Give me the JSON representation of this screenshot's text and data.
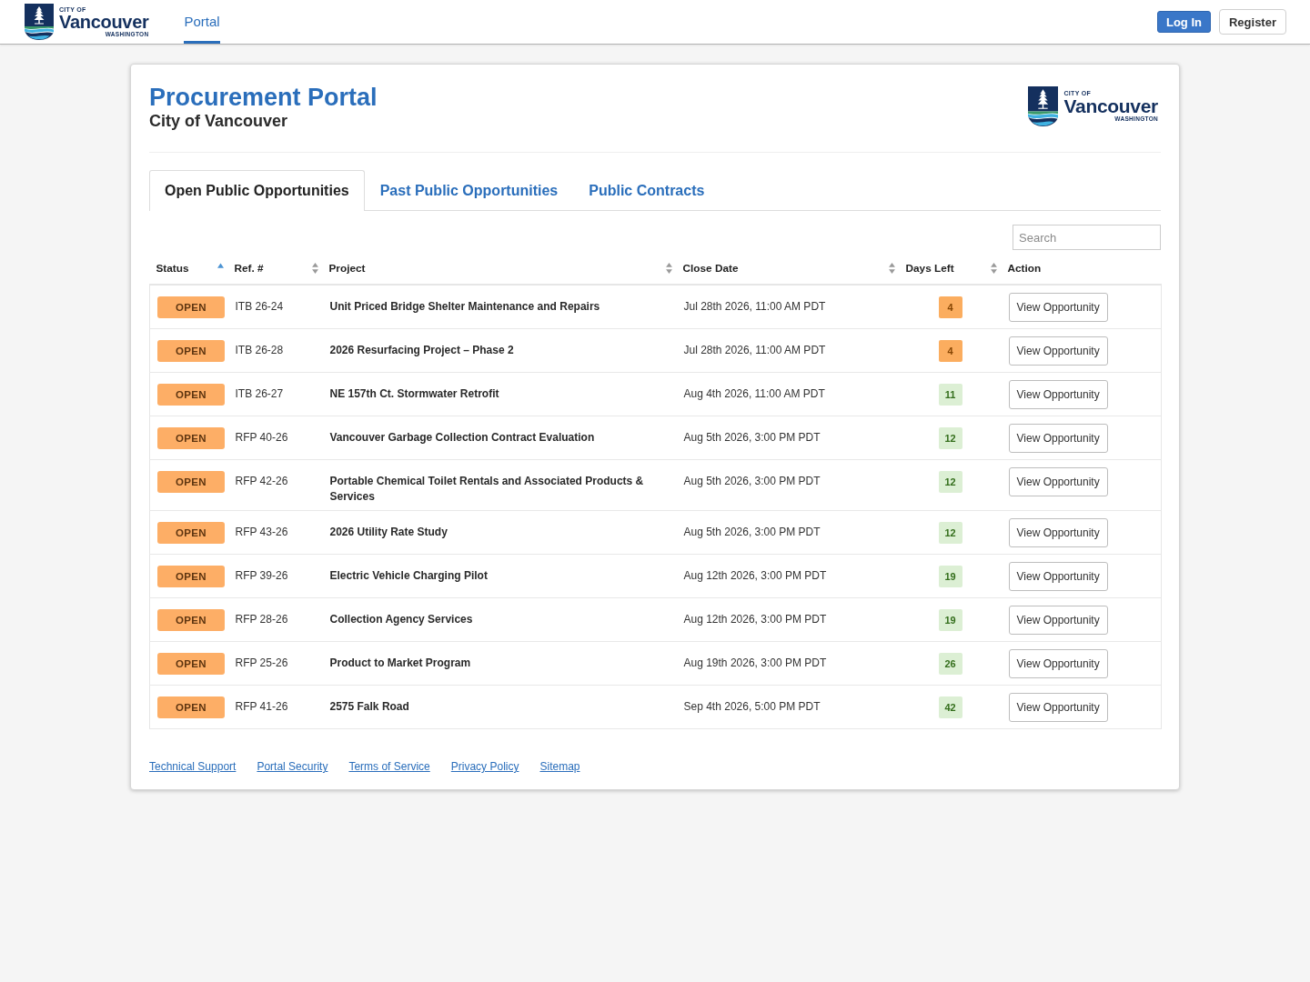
{
  "navbar": {
    "logo": {
      "line_1": "CITY OF",
      "name": "Vancouver",
      "line_2": "WASHINGTON"
    },
    "links": [
      {
        "label": "Portal",
        "selected": true
      }
    ],
    "buttons": [
      {
        "label": "Log In",
        "kind": "primary"
      },
      {
        "label": "Register",
        "kind": "secondary"
      }
    ]
  },
  "header": {
    "title": "Procurement Portal",
    "subtitle": "City of Vancouver",
    "logo": {
      "line_1": "CITY OF",
      "name": "Vancouver",
      "line_2": "WASHINGTON"
    }
  },
  "tabs": [
    {
      "label": "Open Public Opportunities",
      "selected": true
    },
    {
      "label": "Past Public Opportunities",
      "selected": false
    },
    {
      "label": "Public Contracts",
      "selected": false
    }
  ],
  "search": {
    "placeholder": "Search"
  },
  "table": {
    "columns": [
      {
        "label": "Status",
        "sorted": true
      },
      {
        "label": "Ref. #",
        "sorted": false
      },
      {
        "label": "Project",
        "sorted": false
      },
      {
        "label": "Close Date",
        "sorted": false
      },
      {
        "label": "Days Left",
        "sorted": false
      },
      {
        "label": "Action"
      }
    ],
    "rows": [
      {
        "status": "OPEN",
        "ref": "ITB 26-24",
        "project": "Unit Priced Bridge Shelter Maintenance and Repairs",
        "close_date": "Jul 28th 2026, 11:00 AM PDT",
        "days_left": {
          "text": "4",
          "color": "#fbad5f"
        },
        "action": "View Opportunity"
      },
      {
        "status": "OPEN",
        "ref": "ITB 26-28",
        "project": "2026 Resurfacing Project – Phase 2",
        "close_date": "Jul 28th 2026, 11:00 AM PDT",
        "days_left": {
          "text": "4",
          "color": "#fbad5f"
        },
        "action": "View Opportunity"
      },
      {
        "status": "OPEN",
        "ref": "ITB 26-27",
        "project": "NE 157th Ct. Stormwater Retrofit",
        "close_date": "Aug 4th 2026, 11:00 AM PDT",
        "days_left": {
          "text": "11",
          "color": "#dcefd4"
        },
        "action": "View Opportunity"
      },
      {
        "status": "OPEN",
        "ref": "RFP 40-26",
        "project": "Vancouver Garbage Collection Contract Evaluation",
        "close_date": "Aug 5th 2026, 3:00 PM PDT",
        "days_left": {
          "text": "12",
          "color": "#dcefd4"
        },
        "action": "View Opportunity"
      },
      {
        "status": "OPEN",
        "ref": "RFP 42-26",
        "project": "Portable Chemical Toilet Rentals and Associated Products & Services",
        "close_date": "Aug 5th 2026, 3:00 PM PDT",
        "days_left": {
          "text": "12",
          "color": "#dcefd4"
        },
        "action": "View Opportunity"
      },
      {
        "status": "OPEN",
        "ref": "RFP 43-26",
        "project": "2026 Utility Rate Study",
        "close_date": "Aug 5th 2026, 3:00 PM PDT",
        "days_left": {
          "text": "12",
          "color": "#dcefd4"
        },
        "action": "View Opportunity"
      },
      {
        "status": "OPEN",
        "ref": "RFP 39-26",
        "project": "Electric Vehicle Charging Pilot",
        "close_date": "Aug 12th 2026, 3:00 PM PDT",
        "days_left": {
          "text": "19",
          "color": "#dcefd4"
        },
        "action": "View Opportunity"
      },
      {
        "status": "OPEN",
        "ref": "RFP 28-26",
        "project": "Collection Agency Services",
        "close_date": "Aug 12th 2026, 3:00 PM PDT",
        "days_left": {
          "text": "19",
          "color": "#dcefd4"
        },
        "action": "View Opportunity"
      },
      {
        "status": "OPEN",
        "ref": "RFP 25-26",
        "project": "Product to Market Program",
        "close_date": "Aug 19th 2026, 3:00 PM PDT",
        "days_left": {
          "text": "26",
          "color": "#dcefd4"
        },
        "action": "View Opportunity"
      },
      {
        "status": "OPEN",
        "ref": "RFP 41-26",
        "project": "2575 Falk Road",
        "close_date": "Sep 4th 2026, 5:00 PM PDT",
        "days_left": {
          "text": "42",
          "color": "#dcefd4"
        },
        "action": "View Opportunity"
      }
    ]
  },
  "footer_links": [
    "Technical Support",
    "Portal Security",
    "Terms of Service",
    "Privacy Policy",
    "Sitemap"
  ]
}
